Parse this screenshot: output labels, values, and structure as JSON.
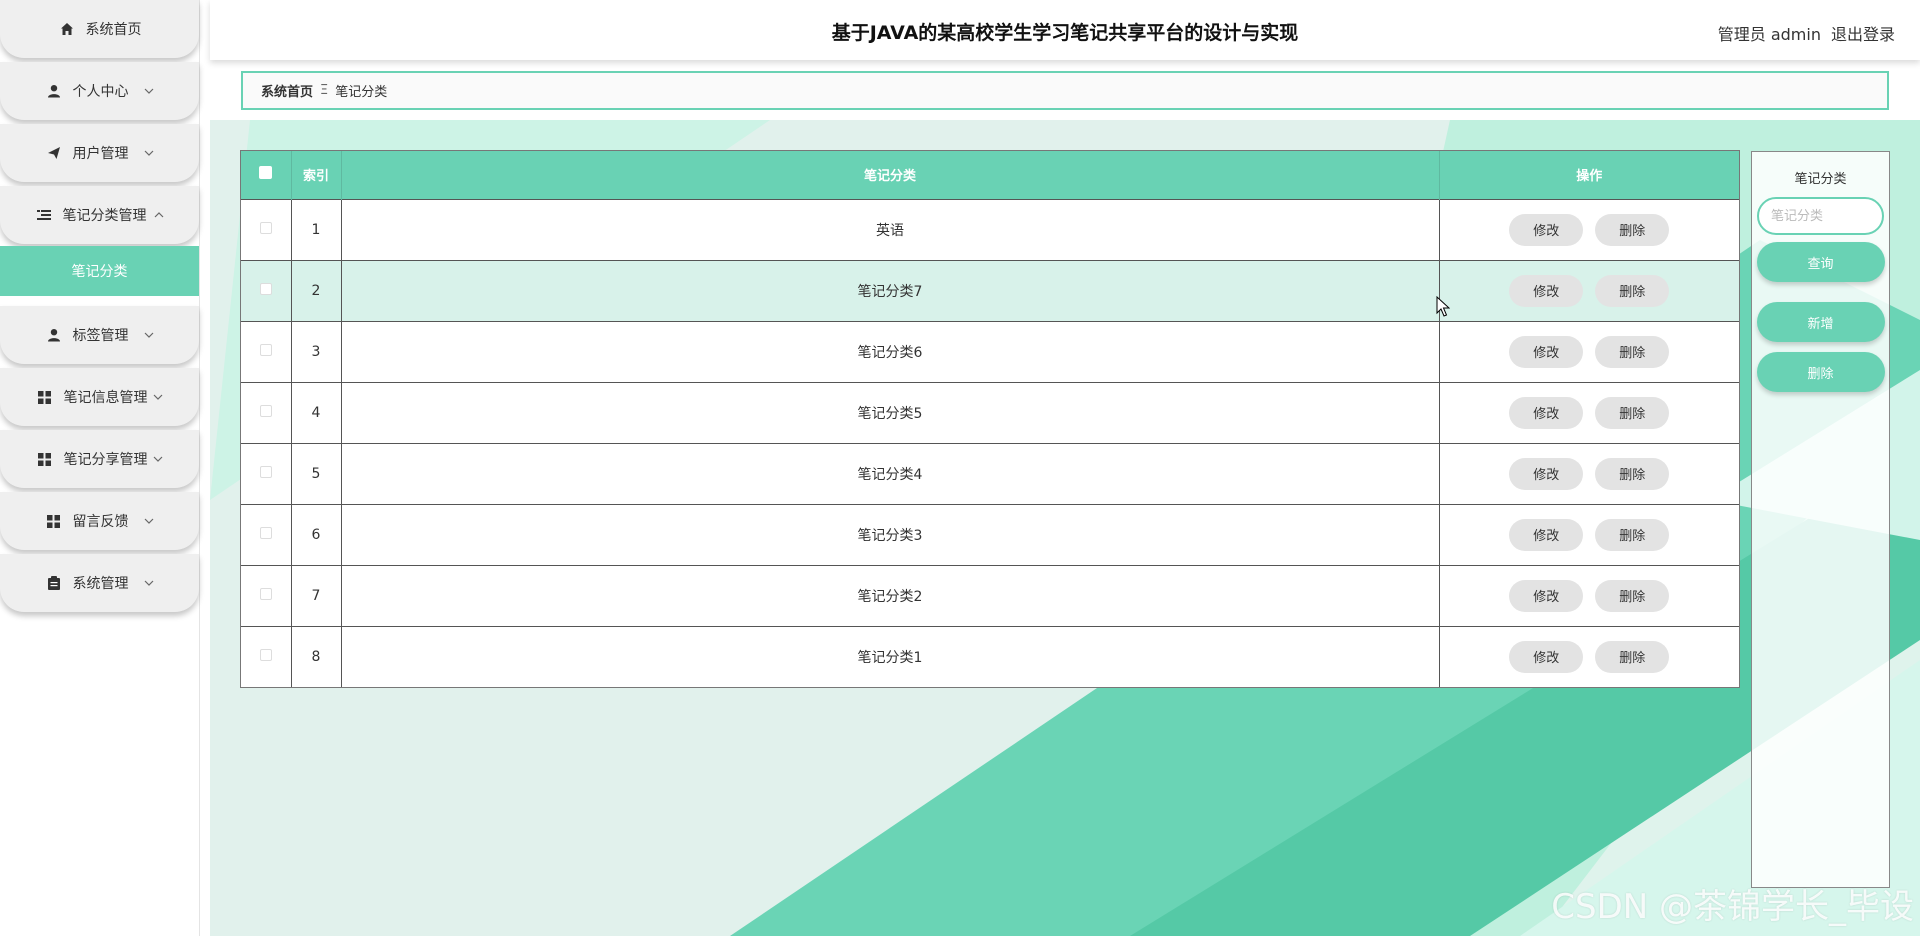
{
  "header": {
    "title": "基于JAVA的某高校学生学习笔记共享平台的设计与实现",
    "user": "管理员 admin",
    "logout": "退出登录"
  },
  "sidebar": {
    "items": [
      {
        "label": "系统首页",
        "icon": "home-icon",
        "chevron": ""
      },
      {
        "label": "个人中心",
        "icon": "user-icon",
        "chevron": "down"
      },
      {
        "label": "用户管理",
        "icon": "send-icon",
        "chevron": "down"
      },
      {
        "label": "笔记分类管理",
        "icon": "list-icon",
        "chevron": "up"
      },
      {
        "label": "标签管理",
        "icon": "user-icon",
        "chevron": "down"
      },
      {
        "label": "笔记信息管理",
        "icon": "grid-icon",
        "chevron": "down"
      },
      {
        "label": "笔记分享管理",
        "icon": "grid-icon",
        "chevron": "down"
      },
      {
        "label": "留言反馈",
        "icon": "grid-icon",
        "chevron": "down"
      },
      {
        "label": "系统管理",
        "icon": "clipboard-icon",
        "chevron": "down"
      }
    ],
    "active_sub": "笔记分类"
  },
  "breadcrumb": {
    "home": "系统首页",
    "separator": "Ξ",
    "current": "笔记分类"
  },
  "table": {
    "headers": {
      "index": "索引",
      "category": "笔记分类",
      "ops": "操作"
    },
    "edit_label": "修改",
    "delete_label": "删除",
    "rows": [
      {
        "index": "1",
        "category": "英语"
      },
      {
        "index": "2",
        "category": "笔记分类7"
      },
      {
        "index": "3",
        "category": "笔记分类6"
      },
      {
        "index": "4",
        "category": "笔记分类5"
      },
      {
        "index": "5",
        "category": "笔记分类4"
      },
      {
        "index": "6",
        "category": "笔记分类3"
      },
      {
        "index": "7",
        "category": "笔记分类2"
      },
      {
        "index": "8",
        "category": "笔记分类1"
      }
    ],
    "hovered_row": 2
  },
  "search": {
    "title": "笔记分类",
    "placeholder": "笔记分类",
    "query": "查询",
    "add": "新增",
    "delete": "删除"
  },
  "watermark": "CSDN @茶锦学长_毕设",
  "colors": {
    "accent": "#69d2b4",
    "accent_dark": "#4fc9a6"
  }
}
